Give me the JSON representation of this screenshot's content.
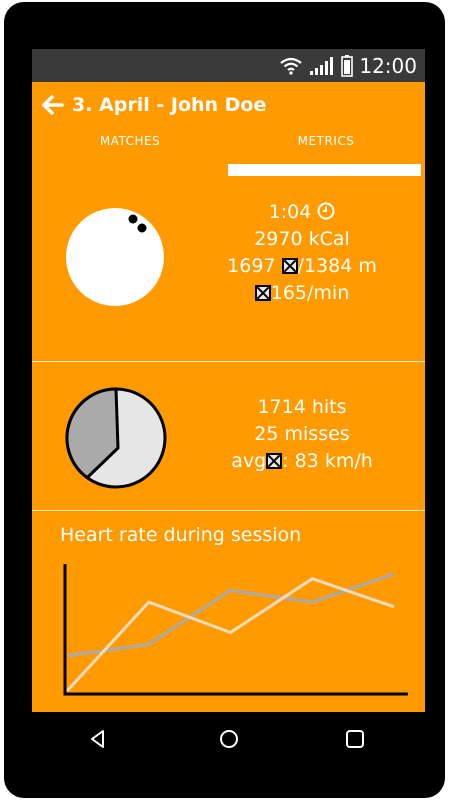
{
  "status": {
    "time": "12:00"
  },
  "header": {
    "title": "3. April - John Doe",
    "tabs": [
      {
        "label": "MATCHES",
        "active": false
      },
      {
        "label": "METRICS",
        "active": true
      }
    ]
  },
  "session": {
    "duration": "1:04",
    "calories": "2970 kCal",
    "distance_a": "1697",
    "distance_b": "/1384 m",
    "rate": "165/min"
  },
  "hits": {
    "hits": "1714 hits",
    "misses": "25 misses",
    "avg_prefix": "avg",
    "avg_value": ": 83 km/h",
    "pie_fraction_dark": 0.4
  },
  "chart": {
    "title": "Heart rate during session"
  },
  "chart_data": {
    "type": "line",
    "title": "Heart rate during session",
    "x": [
      0,
      1,
      2,
      3,
      4
    ],
    "series": [
      {
        "values": [
          0,
          0.76,
          0.5,
          0.96,
          0.72
        ]
      },
      {
        "values": [
          0.3,
          0.4,
          0.86,
          0.76,
          1.0
        ]
      }
    ],
    "grid": false,
    "colors": [
      "#f4dcc0",
      "#aaaaaa"
    ]
  },
  "colors": {
    "accent": "#ff9a00",
    "statusbar": "#3a3a3a",
    "nav": "#000000"
  }
}
